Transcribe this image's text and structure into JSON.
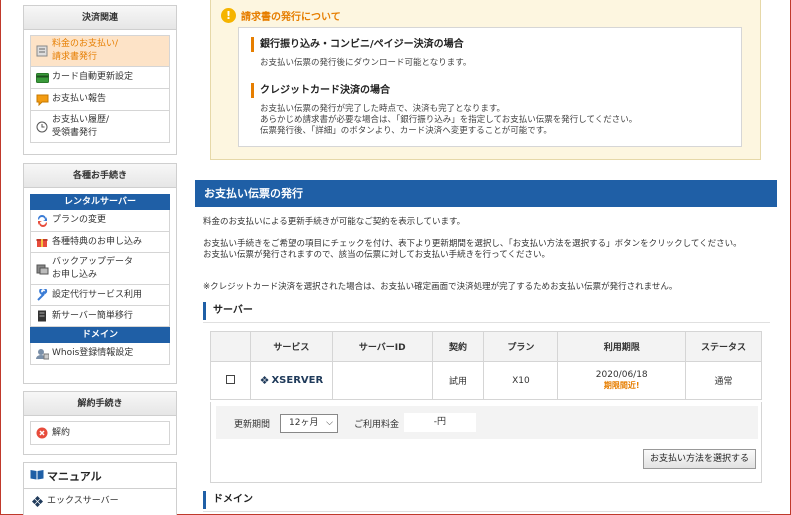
{
  "sidebar": {
    "payment": {
      "header": "決済関連",
      "items": [
        {
          "icon": "bill-icon",
          "label": "料金のお支払い/\n請求書発行"
        },
        {
          "icon": "credit-card-icon",
          "label": "カード自動更新設定"
        },
        {
          "icon": "report-icon",
          "label": "お支払い報告"
        },
        {
          "icon": "clock-icon",
          "label": "お支払い履歴/\n受領書発行"
        }
      ]
    },
    "procedures": {
      "header": "各種お手続き",
      "rental_header": "レンタルサーバー",
      "rental_items": [
        {
          "icon": "plan-change-icon",
          "label": "プランの変更"
        },
        {
          "icon": "gift-icon",
          "label": "各種特典のお申し込み"
        },
        {
          "icon": "backup-icon",
          "label": "バックアップデータ\nお申し込み"
        },
        {
          "icon": "wrench-icon",
          "label": "設定代行サービス利用"
        },
        {
          "icon": "server-icon",
          "label": "新サーバー簡単移行"
        }
      ],
      "domain_header": "ドメイン",
      "domain_items": [
        {
          "icon": "whois-user-icon",
          "label": "Whois登録情報設定"
        }
      ]
    },
    "cancel": {
      "header": "解約手続き",
      "items": [
        {
          "icon": "cancel-icon",
          "label": "解約"
        }
      ]
    },
    "manual": {
      "header": "マニュアル",
      "items": [
        {
          "icon": "xserver-diamond-icon",
          "label": "エックスサーバー"
        }
      ]
    }
  },
  "notice": {
    "title": "請求書の発行について",
    "sections": [
      {
        "heading": "銀行振り込み・コンビニ/ペイジー決済の場合",
        "body": "お支払い伝票の発行後にダウンロード可能となります。"
      },
      {
        "heading": "クレジットカード決済の場合",
        "body": "お支払い伝票の発行が完了した時点で、決済も完了となります。\nあらかじめ請求書が必要な場合は、「銀行振り込み」を指定してお支払い伝票を発行してください。\n伝票発行後、「詳細」のボタンより、カード決済へ変更することが可能です。"
      }
    ]
  },
  "main": {
    "title": "お支払い伝票の発行",
    "intro": "料金のお支払いによる更新手続きが可能なご契約を表示しています。",
    "instructions": "お支払い手続きをご希望の項目にチェックを付け、表下より更新期間を選択し、「お支払い方法を選択する」ボタンをクリックしてください。\nお支払い伝票が発行されますので、該当の伝票に対してお支払い手続きを行ってください。",
    "note": "※クレジットカード決済を選択された場合は、お支払い確定画面で決済処理が完了するためお支払い伝票が発行されません。",
    "server_section": "サーバー",
    "table": {
      "headers": [
        "",
        "サービス",
        "サーバーID",
        "契約",
        "プラン",
        "利用期限",
        "ステータス"
      ],
      "rows": [
        {
          "service": "XSERVER",
          "server_id": "",
          "contract": "試用",
          "plan": "X10",
          "expiry": "2020/06/18",
          "expiry_note": "期限間近!",
          "status": "通常"
        }
      ]
    },
    "renew_label": "更新期間",
    "renew_value": "12ヶ月",
    "fee_label": "ご利用料金",
    "fee_value": "-円",
    "pay_button": "お支払い方法を選択する",
    "domain_section": "ドメイン"
  }
}
